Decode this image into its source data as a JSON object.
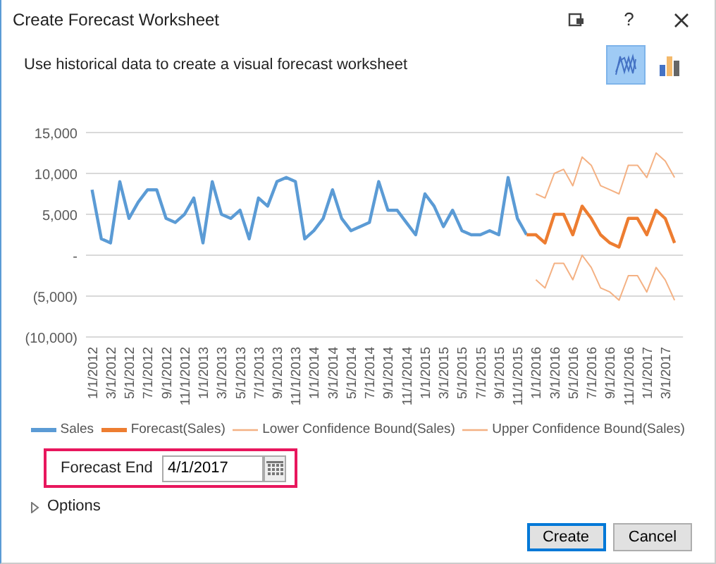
{
  "window": {
    "title": "Create Forecast Worksheet"
  },
  "title_controls": [
    {
      "kind": "restore"
    },
    {
      "kind": "text",
      "label": "?"
    },
    {
      "kind": "close"
    }
  ],
  "description": "Use historical data to create a visual forecast worksheet",
  "chart_types": [
    {
      "kind": "line",
      "selected": true
    },
    {
      "kind": "column",
      "selected": false
    }
  ],
  "chart_data": {
    "type": "line",
    "categories": [
      "1/1/2012",
      null,
      "3/1/2012",
      null,
      "5/1/2012",
      null,
      "7/1/2012",
      null,
      "9/1/2012",
      null,
      "11/1/2012",
      null,
      "1/1/2013",
      null,
      "3/1/2013",
      null,
      "5/1/2013",
      null,
      "7/1/2013",
      null,
      "9/1/2013",
      null,
      "11/1/2013",
      null,
      "1/1/2014",
      null,
      "3/1/2014",
      null,
      "5/1/2014",
      null,
      "7/1/2014",
      null,
      "9/1/2014",
      null,
      "11/1/2014",
      null,
      "1/1/2015",
      null,
      "3/1/2015",
      null,
      "5/1/2015",
      null,
      "7/1/2015",
      null,
      "9/1/2015",
      null,
      "11/1/2015",
      null,
      "1/1/2016",
      null,
      "3/1/2016",
      null,
      "5/1/2016",
      null,
      "7/1/2016",
      null,
      "9/1/2016",
      null,
      "11/1/2016",
      null,
      "1/1/2017",
      null,
      "3/1/2017",
      null
    ],
    "ylim": [
      -10000,
      15000
    ],
    "grid": true,
    "legend": "bottom",
    "yticks": [
      {
        "value": 15000,
        "label": "15,000"
      },
      {
        "value": 10000,
        "label": "10,000"
      },
      {
        "value": 5000,
        "label": "5,000"
      },
      {
        "value": 0,
        "label": "-"
      },
      {
        "value": -5000,
        "label": "(5,000)"
      },
      {
        "value": -10000,
        "label": "(10,000)"
      }
    ],
    "series": [
      {
        "name": "Sales",
        "color": "#5b9bd5",
        "values": [
          8000,
          2000,
          1500,
          9000,
          4500,
          6500,
          8000,
          8000,
          4500,
          4000,
          5000,
          7000,
          1500,
          9000,
          5000,
          4500,
          5500,
          2000,
          7000,
          6000,
          9000,
          9500,
          9000,
          2000,
          3000,
          4500,
          8000,
          4500,
          3000,
          3500,
          4000,
          9000,
          5500,
          5500,
          4000,
          2500,
          7500,
          6000,
          3500,
          5500,
          3000,
          2500,
          2500,
          3000,
          2500,
          9500,
          4500,
          2500,
          null,
          null,
          null,
          null,
          null,
          null,
          null,
          null,
          null,
          null,
          null,
          null,
          null,
          null,
          null,
          null
        ]
      },
      {
        "name": "Forecast(Sales)",
        "color": "#ed7d31",
        "values": [
          null,
          null,
          null,
          null,
          null,
          null,
          null,
          null,
          null,
          null,
          null,
          null,
          null,
          null,
          null,
          null,
          null,
          null,
          null,
          null,
          null,
          null,
          null,
          null,
          null,
          null,
          null,
          null,
          null,
          null,
          null,
          null,
          null,
          null,
          null,
          null,
          null,
          null,
          null,
          null,
          null,
          null,
          null,
          null,
          null,
          null,
          null,
          2500,
          2500,
          1500,
          5000,
          5000,
          2500,
          6000,
          4500,
          2500,
          1500,
          1000,
          4500,
          4500,
          2500,
          5500,
          4500,
          1500
        ]
      },
      {
        "name": "Lower Confidence Bound(Sales)",
        "color": "#f4b183",
        "values": [
          null,
          null,
          null,
          null,
          null,
          null,
          null,
          null,
          null,
          null,
          null,
          null,
          null,
          null,
          null,
          null,
          null,
          null,
          null,
          null,
          null,
          null,
          null,
          null,
          null,
          null,
          null,
          null,
          null,
          null,
          null,
          null,
          null,
          null,
          null,
          null,
          null,
          null,
          null,
          null,
          null,
          null,
          null,
          null,
          null,
          null,
          null,
          null,
          -3000,
          -4000,
          -1000,
          -1000,
          -3000,
          0,
          -1500,
          -4000,
          -4500,
          -5500,
          -2500,
          -2500,
          -4500,
          -1500,
          -3000,
          -5500
        ]
      },
      {
        "name": "Upper Confidence Bound(Sales)",
        "color": "#f4b183",
        "values": [
          null,
          null,
          null,
          null,
          null,
          null,
          null,
          null,
          null,
          null,
          null,
          null,
          null,
          null,
          null,
          null,
          null,
          null,
          null,
          null,
          null,
          null,
          null,
          null,
          null,
          null,
          null,
          null,
          null,
          null,
          null,
          null,
          null,
          null,
          null,
          null,
          null,
          null,
          null,
          null,
          null,
          null,
          null,
          null,
          null,
          null,
          null,
          null,
          7500,
          7000,
          10000,
          10500,
          8500,
          12000,
          11000,
          8500,
          8000,
          7500,
          11000,
          11000,
          9500,
          12500,
          11500,
          9500
        ]
      }
    ]
  },
  "forecast_end": {
    "label": "Forecast End",
    "value": "4/1/2017"
  },
  "options": {
    "label": "Options",
    "expanded": false
  },
  "buttons": [
    {
      "label": "Create",
      "default": true
    },
    {
      "label": "Cancel",
      "default": false
    }
  ]
}
